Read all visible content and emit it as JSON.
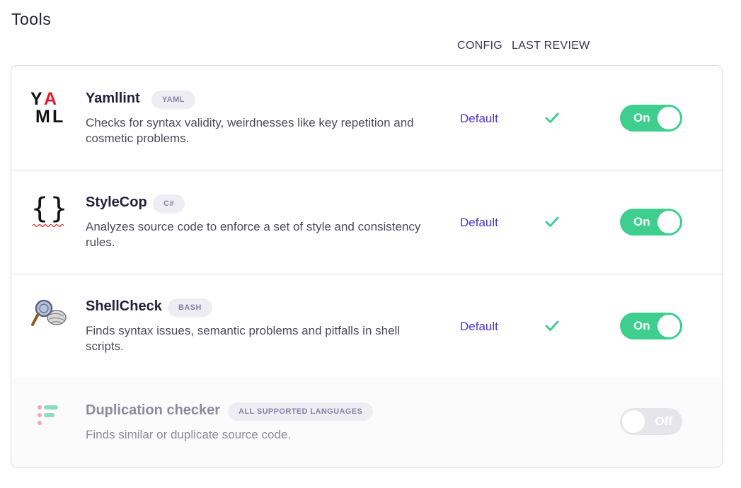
{
  "page": {
    "title": "Tools"
  },
  "columns": {
    "config": "CONFIG",
    "last_review": "LAST REVIEW"
  },
  "colors": {
    "accent_link": "#4b30c8",
    "toggle_on": "#3ecf8e",
    "toggle_off": "#e6e5ec",
    "check": "#3ecf8e"
  },
  "tools": [
    {
      "name": "Yamllint",
      "badge": "YAML",
      "description": "Checks for syntax validity, weirdnesses like key repetition and cosmetic problems.",
      "config": "Default",
      "reviewed": true,
      "toggle": "On",
      "icon": "yaml-logo-icon"
    },
    {
      "name": "StyleCop",
      "badge": "C#",
      "description": "Analyzes source code to enforce a set of style and consistency rules.",
      "config": "Default",
      "reviewed": true,
      "toggle": "On",
      "icon": "curly-braces-icon"
    },
    {
      "name": "ShellCheck",
      "badge": "BASH",
      "description": "Finds syntax issues, semantic problems and pitfalls in shell scripts.",
      "config": "Default",
      "reviewed": true,
      "toggle": "On",
      "icon": "magnifier-shells-icon"
    },
    {
      "name": "Duplication checker",
      "badge": "ALL SUPPORTED LANGUAGES",
      "description": "Finds similar or duplicate source code.",
      "config": "",
      "reviewed": false,
      "toggle": "Off",
      "icon": "duplication-icon"
    }
  ]
}
